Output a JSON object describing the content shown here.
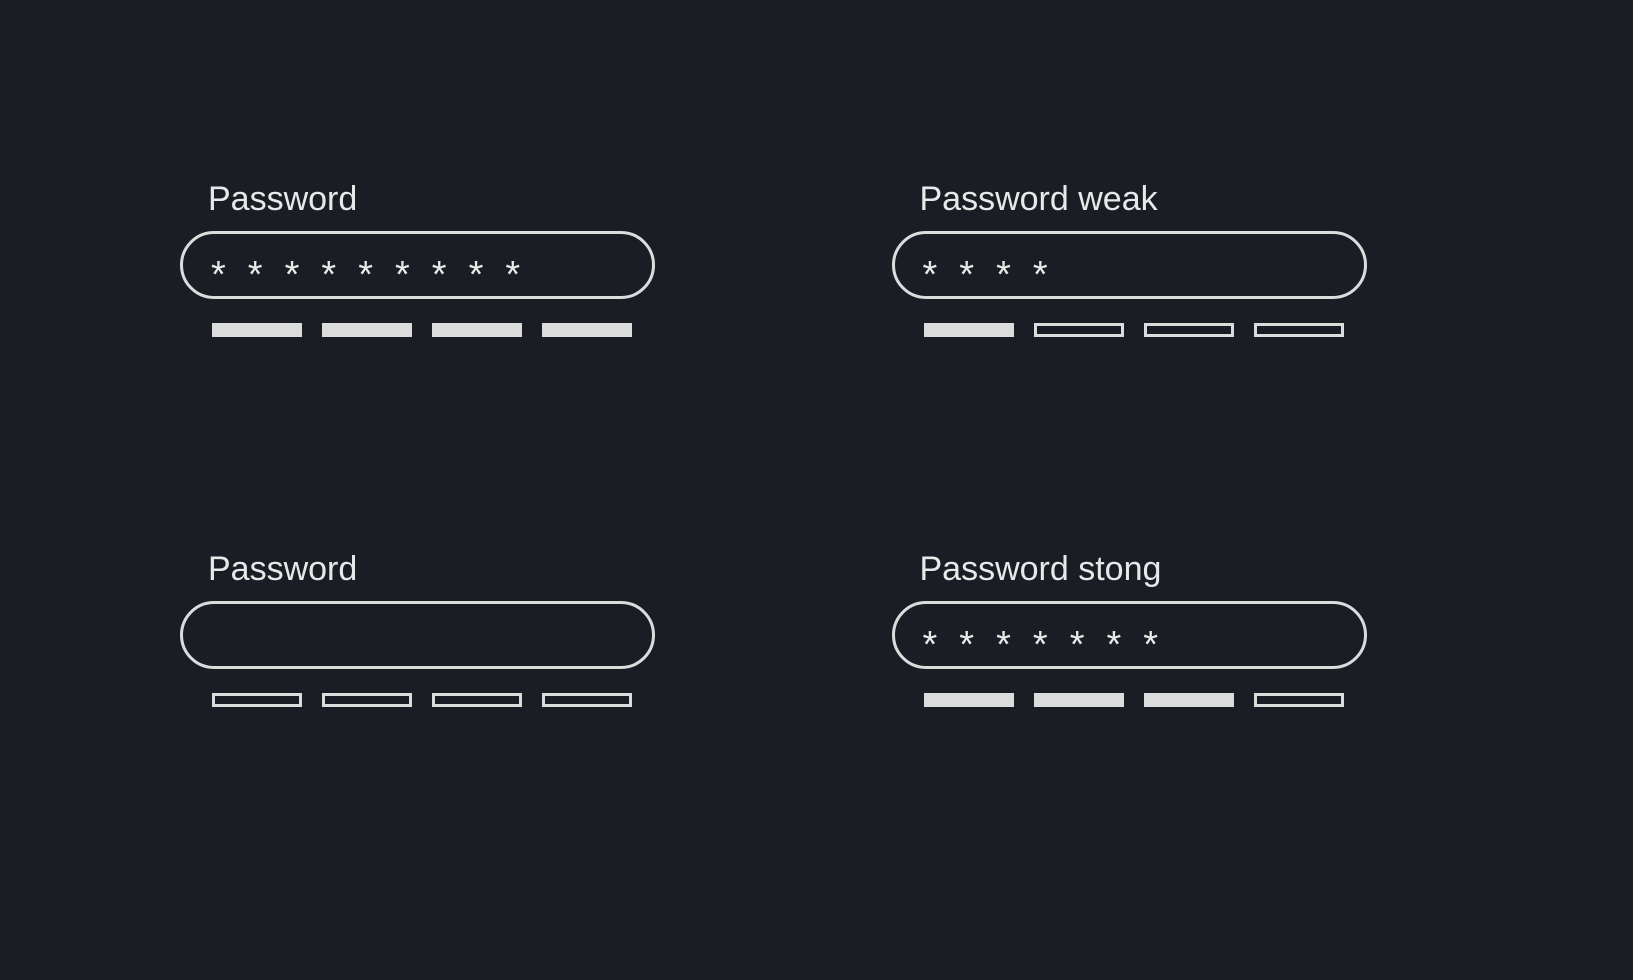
{
  "fields": {
    "topLeft": {
      "label": "Password",
      "maskChar": "*",
      "charCount": 9,
      "strengthFilled": 4,
      "strengthTotal": 4
    },
    "topRight": {
      "label": "Password weak",
      "maskChar": "*",
      "charCount": 4,
      "strengthFilled": 1,
      "strengthTotal": 4
    },
    "bottomLeft": {
      "label": "Password",
      "maskChar": "*",
      "charCount": 0,
      "strengthFilled": 0,
      "strengthTotal": 4
    },
    "bottomRight": {
      "label": "Password stong",
      "maskChar": "*",
      "charCount": 7,
      "strengthFilled": 3,
      "strengthTotal": 4
    }
  },
  "colors": {
    "background": "#1a1e24",
    "foreground": "#e8e8e8",
    "border": "#dcdcdc"
  }
}
